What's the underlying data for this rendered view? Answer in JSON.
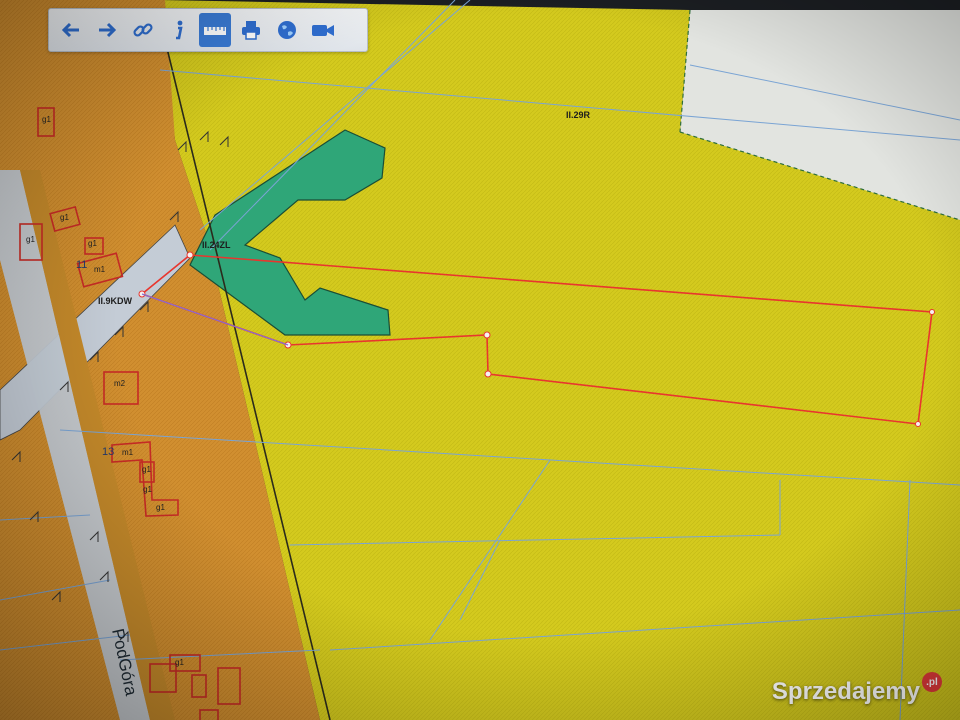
{
  "toolbar": {
    "buttons": [
      {
        "name": "back-arrow-icon",
        "active": false
      },
      {
        "name": "forward-arrow-icon",
        "active": false
      },
      {
        "name": "link-icon",
        "active": false
      },
      {
        "name": "info-icon",
        "active": false
      },
      {
        "name": "measure-ruler-icon",
        "active": true
      },
      {
        "name": "print-icon",
        "active": false
      },
      {
        "name": "globe-icon",
        "active": false
      },
      {
        "name": "camera-icon",
        "active": false
      }
    ]
  },
  "zones": {
    "agricultural": "II.29R",
    "green": "II.24ZL",
    "road": "II.9KDW"
  },
  "street": "PodGóra",
  "building_labels": [
    "m1",
    "m2",
    "m1",
    "g1",
    "g1",
    "g1",
    "g1",
    "g1",
    "g1",
    "g1",
    "g1"
  ],
  "section_numbers": [
    "11",
    "13"
  ],
  "watermark": {
    "text": "Sprzedajemy",
    "suffix": ".pl"
  },
  "colors": {
    "agricultural": "#d6cc1c",
    "residential": "#d6922c",
    "forest": "#2fa678",
    "road": "#bfc7d2",
    "parcel_line": "#7aa4d4",
    "selection": "#e8362e"
  }
}
